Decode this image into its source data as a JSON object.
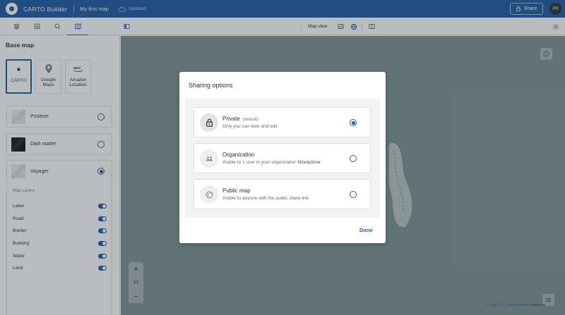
{
  "header": {
    "app_title": "CARTO Builder",
    "map_name": "My first map",
    "status": "Updated",
    "share_label": "Share",
    "avatar_initials": "PR"
  },
  "toolbar": {
    "map_view_label": "Map view"
  },
  "sidebar": {
    "title": "Base map",
    "providers": [
      {
        "label": "CARTO",
        "icon": "carto-logo-icon",
        "selected": true
      },
      {
        "label": "Google Maps",
        "icon": "map-pin-icon",
        "selected": false
      },
      {
        "label": "Amazon Location",
        "icon": "aws-logo-icon",
        "selected": false
      }
    ],
    "styles": [
      {
        "label": "Positron",
        "selected": false
      },
      {
        "label": "Dark matter",
        "selected": false
      },
      {
        "label": "Voyager",
        "selected": true
      }
    ],
    "layers_title": "Map Layers",
    "layers": [
      {
        "label": "Label",
        "on": true
      },
      {
        "label": "Road",
        "on": true
      },
      {
        "label": "Border",
        "on": true
      },
      {
        "label": "Building",
        "on": true
      },
      {
        "label": "Water",
        "on": true
      },
      {
        "label": "Land",
        "on": true
      }
    ]
  },
  "map": {
    "zoom_level": "10",
    "attribution_carto": "© CARTO,",
    "attribution_osm": "© OpenStreetMap",
    "attribution_contrib": "contributors"
  },
  "dialog": {
    "title": "Sharing options",
    "options": [
      {
        "title": "Private",
        "tag": "(default)",
        "desc": "Only you can view and edit",
        "selected": true
      },
      {
        "title": "Organization",
        "desc": "Visible to 1 user in your organization",
        "org": "Nicelydone",
        "selected": false
      },
      {
        "title": "Public map",
        "desc": "Visible to anyone with the public share link",
        "selected": false
      }
    ],
    "done_label": "Done"
  },
  "colors": {
    "brand": "#1f5aa6",
    "map_water": "#7e9396"
  }
}
